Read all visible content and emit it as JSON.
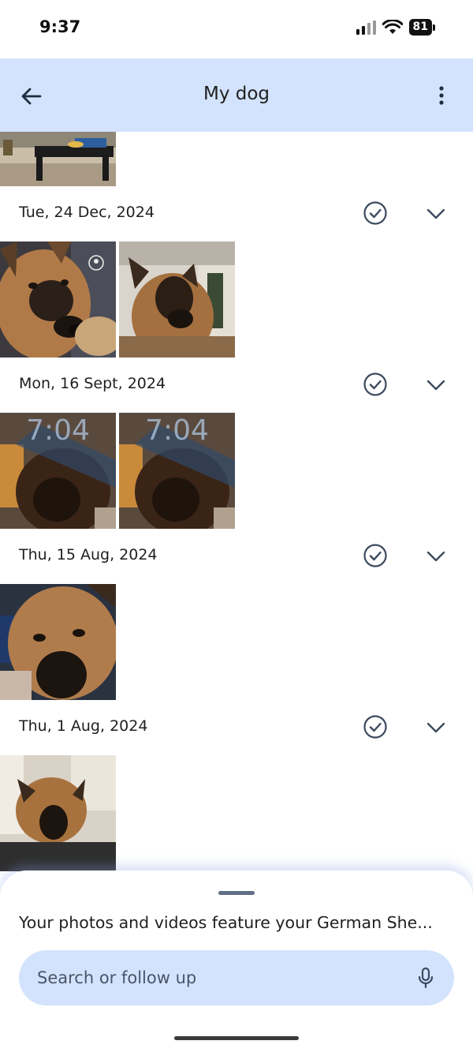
{
  "status_bar": {
    "time": "9:37",
    "battery": "81"
  },
  "app_bar": {
    "title": "My dog",
    "back_icon": "arrow-left-icon",
    "more_icon": "more-vert-icon"
  },
  "groups": [
    {
      "date": "Tue, 24 Dec, 2024",
      "photo_count": 2
    },
    {
      "date": "Mon, 16 Sept, 2024",
      "photo_count": 2,
      "overlay_text": "7:04"
    },
    {
      "date": "Thu, 15 Aug, 2024",
      "photo_count": 1
    },
    {
      "date": "Thu, 1 Aug, 2024",
      "photo_count": 1
    }
  ],
  "sheet": {
    "summary": "Your photos and videos feature your German She...",
    "search_placeholder": "Search or follow up",
    "mic_icon": "microphone-icon"
  },
  "colors": {
    "accent": "#d3e3fd",
    "icon": "#3c4a5e"
  }
}
